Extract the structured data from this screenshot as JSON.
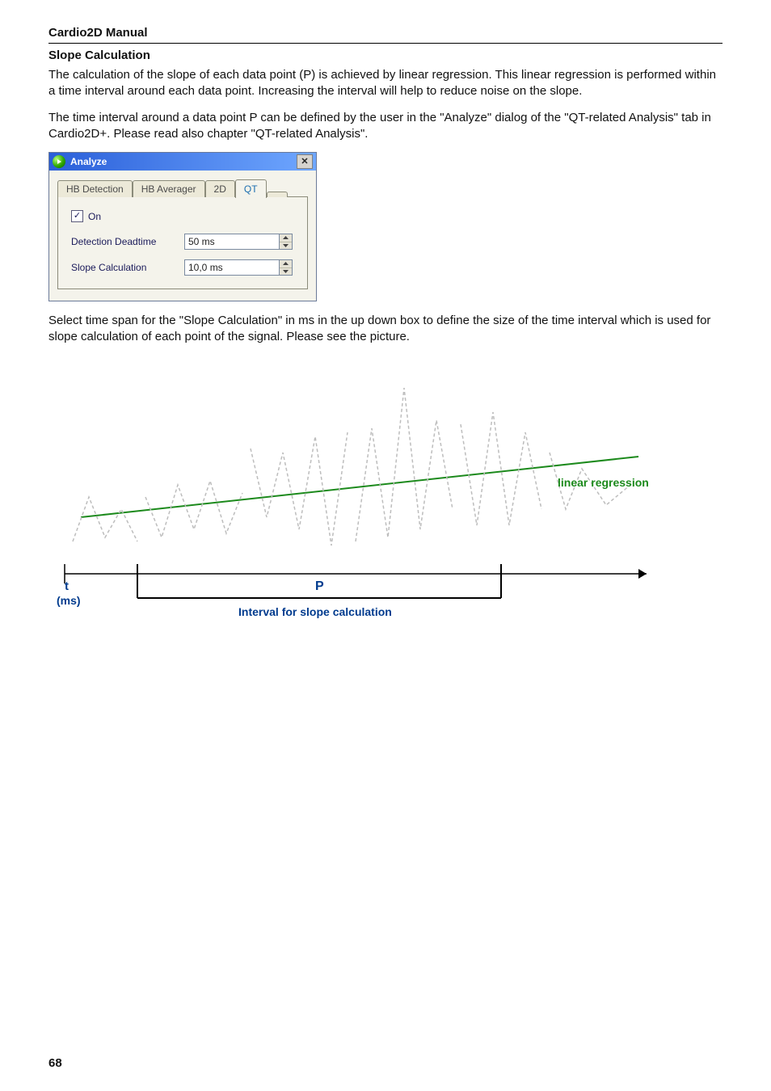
{
  "header": {
    "title": "Cardio2D Manual"
  },
  "section": {
    "title": "Slope Calculation"
  },
  "paragraphs": {
    "p1": "The calculation of the slope of each data point (P) is achieved by linear regression. This linear regression is performed within a time interval around each data point. Increasing the interval will help to reduce noise on the slope.",
    "p2": "The time interval around a data point P can be defined by the user in the \"Analyze\" dialog of the \"QT-related Analysis\" tab in Cardio2D+. Please read also chapter \"QT-related Analysis\".",
    "p3": "Select time span for the \"Slope Calculation\" in ms in the up down box to define the size of the time interval which is used for slope calculation of each point of the signal. Please see the picture."
  },
  "dialog": {
    "title": "Analyze",
    "close_label": "✕",
    "tabs": [
      "HB Detection",
      "HB Averager",
      "2D",
      "QT"
    ],
    "active_tab_index": 3,
    "panel": {
      "on_label": "On",
      "on_checked": true,
      "rows": [
        {
          "label": "Detection Deadtime",
          "value": "50 ms"
        },
        {
          "label": "Slope Calculation",
          "value": "10,0 ms"
        }
      ]
    }
  },
  "diagram": {
    "linreg_label": "linear regression",
    "t_label": "t",
    "unit_label": "(ms)",
    "p_label": "P",
    "caption": "Interval for slope calculation"
  },
  "page_number": "68"
}
